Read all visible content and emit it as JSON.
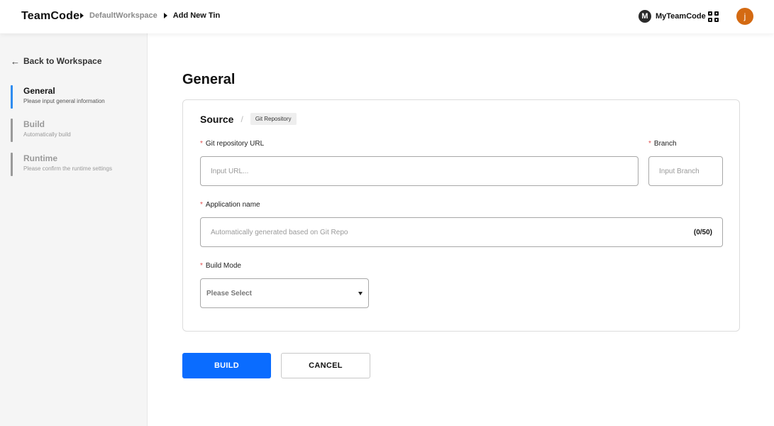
{
  "header": {
    "logo": "TeamCode",
    "breadcrumbs": [
      "DefaultWorkspace",
      "Add New Tin"
    ],
    "team_initial": "M",
    "team_name": "MyTeamCode",
    "apps_icon": "grid-icon",
    "user_initial": "j",
    "user_avatar_color": "#d46a12"
  },
  "sidebar": {
    "back_label": "Back to Workspace",
    "steps": [
      {
        "title": "General",
        "description": "Please input general information",
        "active": true
      },
      {
        "title": "Build",
        "description": "Automatically build",
        "active": false
      },
      {
        "title": "Runtime",
        "description": "Please confirm the runtime settings",
        "active": false
      }
    ],
    "active_color": "#2f8cf0"
  },
  "main": {
    "title": "General",
    "source": {
      "title": "Source",
      "tag": "Git Repository"
    },
    "fields": {
      "git_url": {
        "label": "Git repository URL",
        "placeholder": "Input URL...",
        "required": true
      },
      "branch": {
        "label": "Branch",
        "placeholder": "Input Branch",
        "required": true
      },
      "app_name": {
        "label": "Application name",
        "placeholder": "Automatically generated based on Git Repo",
        "counter": "(0/50)",
        "required": true
      },
      "build_mode": {
        "label": "Build Mode",
        "value": "Please Select",
        "required": true
      }
    },
    "required_mark": "*"
  },
  "actions": {
    "build_label": "BUILD",
    "cancel_label": "CANCEL",
    "primary_color": "#0a6cff"
  }
}
